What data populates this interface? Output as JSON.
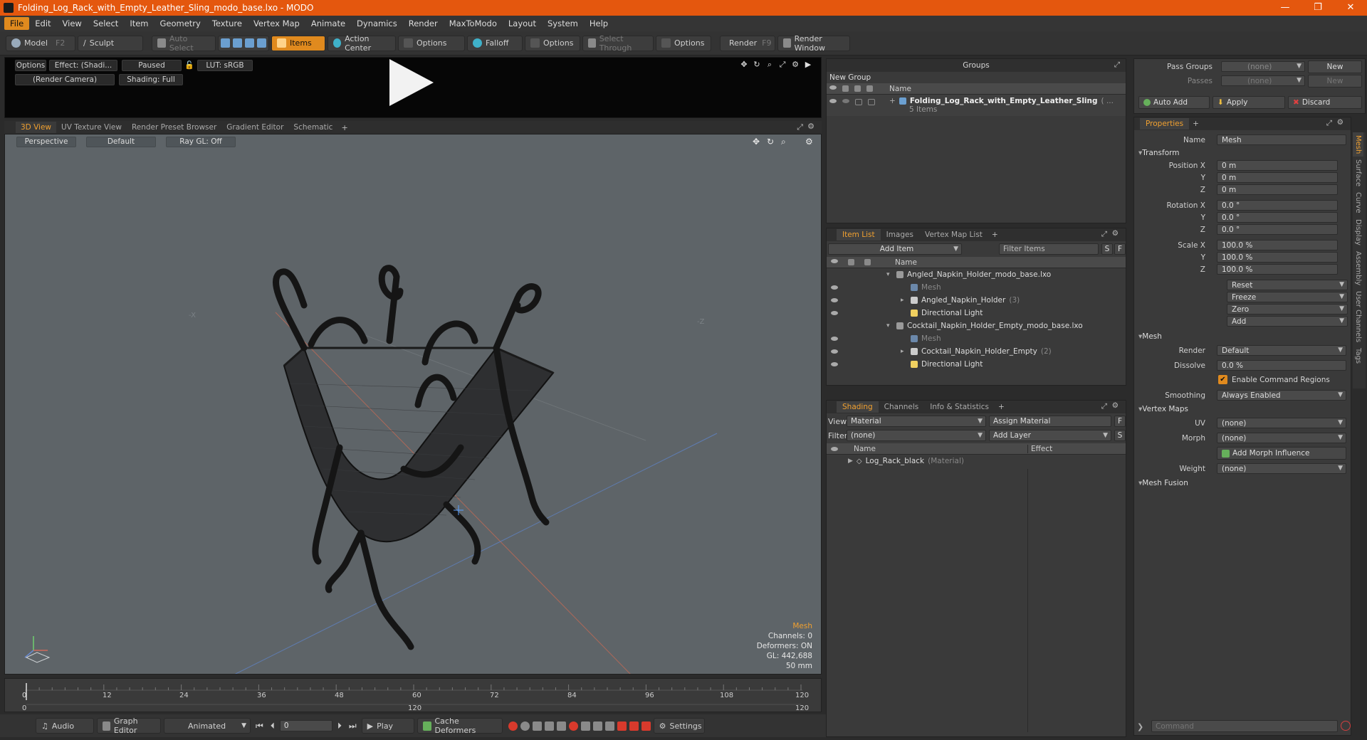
{
  "window": {
    "title": "Folding_Log_Rack_with_Empty_Leather_Sling_modo_base.lxo - MODO",
    "minimize": "—",
    "maximize": "❐",
    "close": "✕"
  },
  "menu": [
    "File",
    "Edit",
    "View",
    "Select",
    "Item",
    "Geometry",
    "Texture",
    "Vertex Map",
    "Animate",
    "Dynamics",
    "Render",
    "MaxToModo",
    "Layout",
    "System",
    "Help"
  ],
  "toolbar": {
    "model": "Model",
    "model_key": "F2",
    "sculpt": "Sculpt",
    "auto_select": "Auto Select",
    "items": "Items",
    "action_center": "Action Center",
    "options1": "Options",
    "falloff": "Falloff",
    "options2": "Options",
    "select_through": "Select Through",
    "options3": "Options",
    "render": "Render",
    "render_key": "F9",
    "render_window": "Render Window"
  },
  "preview": {
    "options": "Options",
    "effect": "Effect: (Shadi...",
    "paused": "Paused",
    "lut": "LUT: sRGB",
    "camera": "(Render Camera)",
    "shading": "Shading: Full"
  },
  "viewport_tabs": [
    "3D View",
    "UV Texture View",
    "Render Preset Browser",
    "Gradient Editor",
    "Schematic"
  ],
  "viewport": {
    "projection": "Perspective",
    "style": "Default",
    "raygl": "Ray GL: Off",
    "axis_label_left": "-X",
    "axis_label_right": "-Z",
    "info": {
      "title": "Mesh",
      "channels": "Channels: 0",
      "deformers": "Deformers: ON",
      "gl": "GL: 442,688",
      "scale": "50 mm"
    }
  },
  "timeline": {
    "ticks": [
      "0",
      "12",
      "24",
      "36",
      "48",
      "60",
      "72",
      "84",
      "96",
      "108",
      "120"
    ],
    "sub_ticks": [
      "0",
      "120",
      "120"
    ]
  },
  "bottombar": {
    "audio": "Audio",
    "graph_editor": "Graph Editor",
    "animated": "Animated",
    "frame": "0",
    "play": "Play",
    "cache": "Cache Deformers",
    "settings": "Settings"
  },
  "groups": {
    "title": "Groups",
    "new_group": "New Group",
    "col_name": "Name",
    "item_name": "Folding_Log_Rack_with_Empty_Leather_Sling",
    "item_suffix": "( ...",
    "item_count": "5 Items"
  },
  "passes": {
    "pass_groups_label": "Pass Groups",
    "pass_groups_value": "(none)",
    "passes_label": "Passes",
    "passes_value": "(none)",
    "new1": "New",
    "new2": "New"
  },
  "actions": {
    "auto_add": "Auto Add",
    "apply": "Apply",
    "discard": "Discard"
  },
  "item_list": {
    "tabs": [
      "Item List",
      "Images",
      "Vertex Map List"
    ],
    "add_item": "Add Item",
    "filter": "Filter Items",
    "s_btn": "S",
    "f_btn": "F",
    "col_name": "Name",
    "rows": [
      {
        "label": "Angled_Napkin_Holder_modo_base.lxo",
        "indent": 0,
        "arrow": "▾",
        "kind": "scene",
        "sub": ""
      },
      {
        "label": "Mesh",
        "indent": 1,
        "arrow": "",
        "kind": "mesh-dim",
        "sub": ""
      },
      {
        "label": "Angled_Napkin_Holder",
        "indent": 1,
        "arrow": "▸",
        "kind": "group",
        "sub": "(3)"
      },
      {
        "label": "Directional Light",
        "indent": 1,
        "arrow": "",
        "kind": "light",
        "sub": ""
      },
      {
        "label": "Cocktail_Napkin_Holder_Empty_modo_base.lxo",
        "indent": 0,
        "arrow": "▾",
        "kind": "scene",
        "sub": ""
      },
      {
        "label": "Mesh",
        "indent": 1,
        "arrow": "",
        "kind": "mesh-dim",
        "sub": ""
      },
      {
        "label": "Cocktail_Napkin_Holder_Empty",
        "indent": 1,
        "arrow": "▸",
        "kind": "group",
        "sub": "(2)"
      },
      {
        "label": "Directional Light",
        "indent": 1,
        "arrow": "",
        "kind": "light",
        "sub": ""
      }
    ]
  },
  "shading": {
    "tabs": [
      "Shading",
      "Channels",
      "Info & Statistics"
    ],
    "view_label": "View",
    "view_value": "Material",
    "assign_material": "Assign Material",
    "f_btn": "F",
    "filter_label": "Filter",
    "filter_value": "(none)",
    "add_layer": "Add Layer",
    "s_btn": "S",
    "col_name": "Name",
    "col_effect": "Effect",
    "row_name": "Log_Rack_black",
    "row_sub": "(Material)"
  },
  "properties": {
    "tab": "Properties",
    "name_label": "Name",
    "name_value": "Mesh",
    "transform": "Transform",
    "position_label": "Position X",
    "rotation_label": "Rotation X",
    "scale_label": "Scale X",
    "y": "Y",
    "z": "Z",
    "pos": [
      "0 m",
      "0 m",
      "0 m"
    ],
    "rot": [
      "0.0 °",
      "0.0 °",
      "0.0 °"
    ],
    "scl": [
      "100.0 %",
      "100.0 %",
      "100.0 %"
    ],
    "reset": "Reset",
    "freeze": "Freeze",
    "zero": "Zero",
    "add": "Add",
    "mesh_section": "Mesh",
    "render_label": "Render",
    "render_value": "Default",
    "dissolve_label": "Dissolve",
    "dissolve_value": "0.0 %",
    "enable_regions": "Enable Command Regions",
    "smoothing_label": "Smoothing",
    "smoothing_value": "Always Enabled",
    "vertex_maps": "Vertex Maps",
    "uv_label": "UV",
    "uv_value": "(none)",
    "morph_label": "Morph",
    "morph_value": "(none)",
    "add_morph": "Add Morph Influence",
    "weight_label": "Weight",
    "weight_value": "(none)",
    "mesh_fusion": "Mesh Fusion",
    "command_placeholder": "Command"
  },
  "side_tabs": [
    "Mesh",
    "Surface",
    "Curve",
    "Display",
    "Assembly",
    "User Channels",
    "Tags"
  ]
}
